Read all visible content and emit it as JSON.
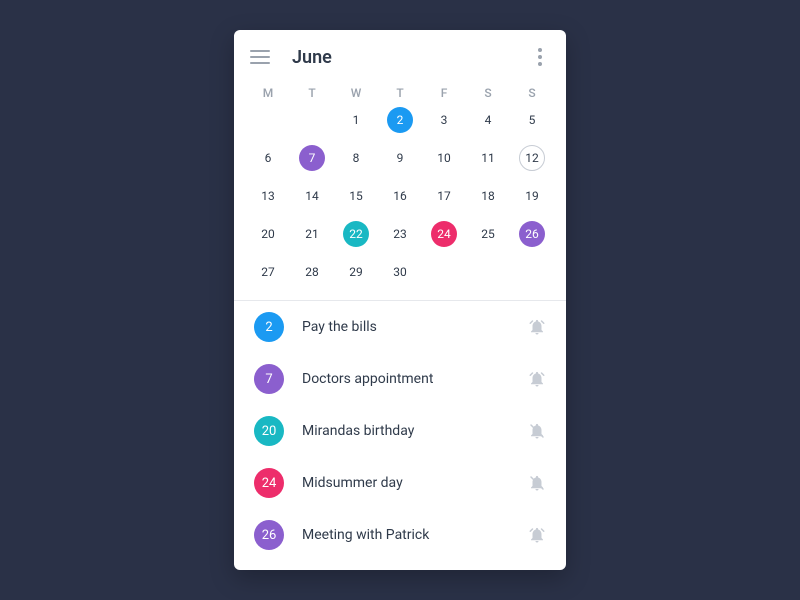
{
  "header": {
    "title": "June"
  },
  "weekdays": [
    "M",
    "T",
    "W",
    "T",
    "F",
    "S",
    "S"
  ],
  "calendar": {
    "startOffset": 2,
    "daysInMonth": 30,
    "today": 12,
    "colored": {
      "2": "blue",
      "7": "purple",
      "22": "teal",
      "24": "pink",
      "26": "purple"
    }
  },
  "events": [
    {
      "day": "2",
      "color": "blue",
      "title": "Pay the bills",
      "alarm": true
    },
    {
      "day": "7",
      "color": "purple",
      "title": "Doctors appointment",
      "alarm": true
    },
    {
      "day": "20",
      "color": "teal",
      "title": "Mirandas birthday",
      "alarm": false
    },
    {
      "day": "24",
      "color": "pink",
      "title": "Midsummer day",
      "alarm": false
    },
    {
      "day": "26",
      "color": "purple",
      "title": "Meeting with Patrick",
      "alarm": true
    }
  ]
}
